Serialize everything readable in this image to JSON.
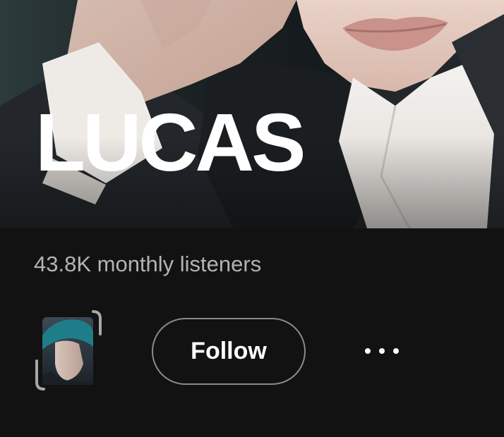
{
  "artist": {
    "name": "LUCAS",
    "monthly_listeners": "43.8K monthly listeners"
  },
  "actions": {
    "follow_label": "Follow",
    "more_icon": "more-horizontal-icon"
  },
  "avatar": {
    "icon": "artist-avatar-thumbnail"
  },
  "colors": {
    "background": "#121212",
    "text_primary": "#FFFFFF",
    "text_secondary": "#B3B3B3",
    "button_border": "#8A8A8A"
  }
}
